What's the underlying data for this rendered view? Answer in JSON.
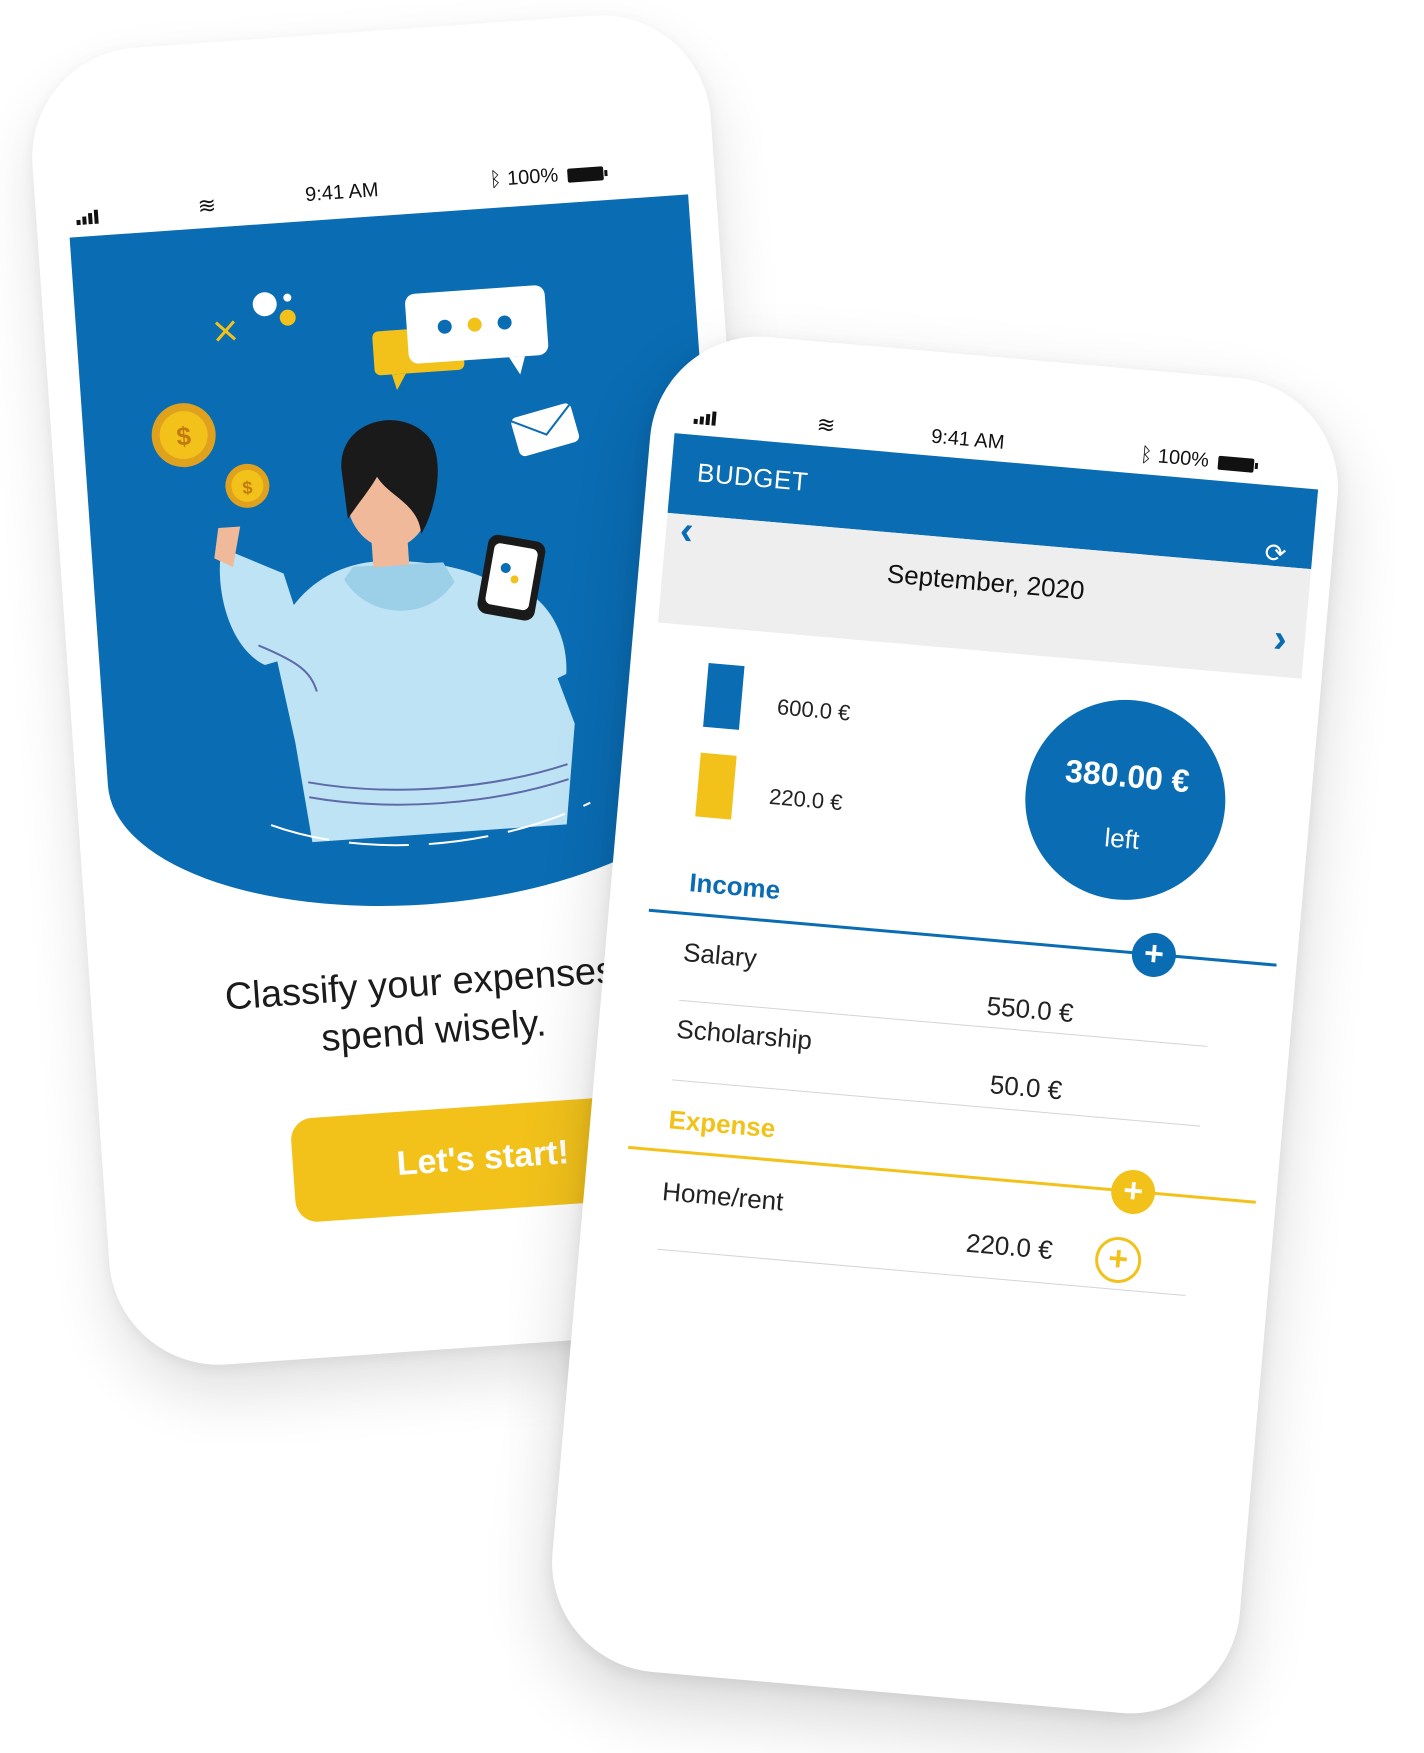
{
  "onboarding": {
    "status": {
      "time": "9:41 AM",
      "battery": "100%"
    },
    "tagline_line1": "Classify your expenses t",
    "tagline_line2": "spend wisely.",
    "cta_label": "Let's start!"
  },
  "budget": {
    "status": {
      "time": "9:41 AM",
      "battery": "100%"
    },
    "app_title": "BUDGET",
    "month": "September, 2020",
    "legend": [
      {
        "value": "600.0 €",
        "color": "#0a6cb3"
      },
      {
        "value": "220.0 €",
        "color": "#f2c21b"
      }
    ],
    "remaining": {
      "amount": "380.00 €",
      "label": "left"
    },
    "income": {
      "title": "Income",
      "color": "#0a6cb3",
      "rows": [
        {
          "label": "Salary",
          "value": "550.0 €"
        },
        {
          "label": "Scholarship",
          "value": "50.0 €"
        }
      ]
    },
    "expense": {
      "title": "Expense",
      "color": "#f2c21b",
      "rows": [
        {
          "label": "Home/rent",
          "value": "220.0 €"
        }
      ]
    }
  },
  "colors": {
    "primary": "#0a6cb3",
    "accent": "#f2c21b"
  }
}
